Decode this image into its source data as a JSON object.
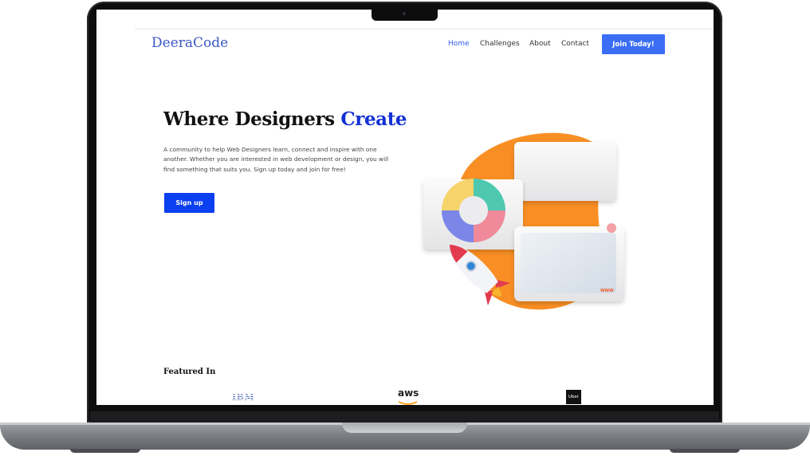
{
  "brand": {
    "logo": "DeeraCode"
  },
  "nav": {
    "items": [
      {
        "label": "Home",
        "active": true
      },
      {
        "label": "Challenges",
        "active": false
      },
      {
        "label": "About",
        "active": false
      },
      {
        "label": "Contact",
        "active": false
      }
    ],
    "cta": "Join Today!"
  },
  "hero": {
    "title_main": "Where Designers ",
    "title_accent": "Create",
    "description": "A community to help Web Designers learn, connect and inspire with one another.  Whether you are interested in web development or design, you will find something that suits you. Sign up today and join for free!",
    "button": "Sign up",
    "illustration_badge": "WWW"
  },
  "featured": {
    "title": "Featured In",
    "logos": [
      "IBM",
      "aws",
      "Uber"
    ]
  },
  "colors": {
    "accent": "#3b6ef5",
    "primary_button": "#0a40f0",
    "title_accent": "#1231d4",
    "blob": "#f98f24"
  }
}
